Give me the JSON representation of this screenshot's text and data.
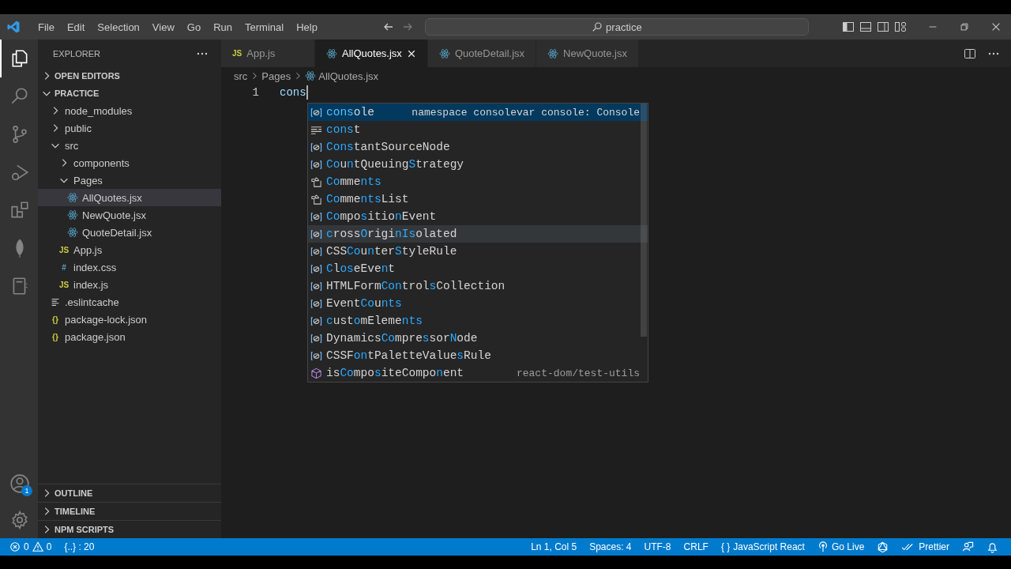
{
  "title_bar": {
    "menu": [
      "File",
      "Edit",
      "Selection",
      "View",
      "Go",
      "Run",
      "Terminal",
      "Help"
    ],
    "forward_disabled": true,
    "search": {
      "value": "practice"
    }
  },
  "activity_bar": {
    "items": [
      {
        "kind": "explorer",
        "selected": true
      },
      {
        "kind": "search",
        "selected": false
      },
      {
        "kind": "source-control",
        "selected": false
      },
      {
        "kind": "run-debug",
        "selected": false
      },
      {
        "kind": "extensions",
        "selected": false
      },
      {
        "kind": "leaf",
        "selected": false
      },
      {
        "kind": "notebook",
        "selected": false
      }
    ],
    "accounts_badge": "1"
  },
  "sidebar": {
    "title": "EXPLORER",
    "sections": [
      {
        "label": "OPEN EDITORS",
        "expanded": false
      },
      {
        "label": "PRACTICE",
        "expanded": true
      }
    ],
    "tree": [
      {
        "label": "node_modules",
        "kind": "folder",
        "expanded": false,
        "selected": false
      },
      {
        "label": "public",
        "kind": "folder",
        "expanded": false,
        "selected": false
      },
      {
        "label": "src",
        "kind": "folder",
        "expanded": true,
        "selected": false,
        "children": [
          {
            "label": "components",
            "kind": "folder",
            "expanded": false,
            "selected": false
          },
          {
            "label": "Pages",
            "kind": "folder",
            "expanded": true,
            "selected": false,
            "children": [
              {
                "label": "AllQuotes.jsx",
                "kind": "react",
                "selected": true
              },
              {
                "label": "NewQuote.jsx",
                "kind": "react",
                "selected": false
              },
              {
                "label": "QuoteDetail.jsx",
                "kind": "react",
                "selected": false
              }
            ]
          },
          {
            "label": "App.js",
            "kind": "js",
            "icon_text": "JS",
            "selected": false
          },
          {
            "label": "index.css",
            "kind": "css",
            "icon_text": "#",
            "selected": false
          },
          {
            "label": "index.js",
            "kind": "js",
            "icon_text": "JS",
            "selected": false
          }
        ]
      },
      {
        "label": ".eslintcache",
        "kind": "text",
        "selected": false
      },
      {
        "label": "package-lock.json",
        "kind": "json",
        "icon_text": "{}",
        "selected": false
      },
      {
        "label": "package.json",
        "kind": "json",
        "icon_text": "{}",
        "selected": false
      }
    ],
    "bottom_sections": [
      {
        "label": "OUTLINE",
        "expanded": false
      },
      {
        "label": "TIMELINE",
        "expanded": false
      },
      {
        "label": "NPM SCRIPTS",
        "expanded": false
      }
    ]
  },
  "tabs": [
    {
      "label": "App.js",
      "kind": "js",
      "icon_text": "JS",
      "selected": false
    },
    {
      "label": "AllQuotes.jsx",
      "kind": "react",
      "selected": true
    },
    {
      "label": "QuoteDetail.jsx",
      "kind": "react",
      "selected": false
    },
    {
      "label": "NewQuote.jsx",
      "kind": "react",
      "selected": false
    }
  ],
  "breadcrumb": [
    {
      "label": "src",
      "kind": "folder"
    },
    {
      "label": "Pages",
      "kind": "folder"
    },
    {
      "label": "AllQuotes.jsx",
      "kind": "react"
    }
  ],
  "editor": {
    "lines": [
      {
        "number": "1",
        "code": "cons"
      }
    ]
  },
  "suggestions": [
    {
      "label": "**cons**ole",
      "kind": "variable",
      "detail": "namespace consolevar console: Console",
      "selected": true,
      "hovered": false
    },
    {
      "label": "**cons**t",
      "kind": "keyword",
      "selected": false,
      "hovered": false
    },
    {
      "label": "**Cons**tantSourceNode",
      "kind": "variable",
      "selected": false,
      "hovered": false
    },
    {
      "label": "**Co**u**n**tQueuing**S**trategy",
      "kind": "variable",
      "selected": false,
      "hovered": false
    },
    {
      "label": "**Co**mme**nts**",
      "kind": "class",
      "selected": false,
      "hovered": false
    },
    {
      "label": "**Co**mme**nts**List",
      "kind": "class",
      "selected": false,
      "hovered": false
    },
    {
      "label": "**Co**mpo**s**itio**n**Event",
      "kind": "variable",
      "selected": false,
      "hovered": false
    },
    {
      "label": "**c**ross**O**rigi**nIs**olated",
      "kind": "variable",
      "selected": false,
      "hovered": true
    },
    {
      "label": "CSS**Co**u**n**ter**S**tyleRule",
      "kind": "variable",
      "selected": false,
      "hovered": false
    },
    {
      "label": "**C**l**os**eEve**n**t",
      "kind": "variable",
      "selected": false,
      "hovered": false
    },
    {
      "label": "HTMLForm**Con**trol**s**Collection",
      "kind": "variable",
      "selected": false,
      "hovered": false
    },
    {
      "label": "Event**Co**u**nts**",
      "kind": "variable",
      "selected": false,
      "hovered": false
    },
    {
      "label": "**c**ust**o**mEleme**nts**",
      "kind": "variable",
      "selected": false,
      "hovered": false
    },
    {
      "label": "Dynamics**Co**mpre**s**sor**N**ode",
      "kind": "variable",
      "selected": false,
      "hovered": false
    },
    {
      "label": "CSSF**on**tPaletteValue**s**Rule",
      "kind": "variable",
      "selected": false,
      "hovered": false
    },
    {
      "label": "is**Co**mpo**s**iteCompo**n**ent",
      "kind": "module",
      "detail": "react-dom/test-utils",
      "selected": false,
      "hovered": false
    }
  ],
  "status_bar": {
    "errors": "0",
    "warnings": "0",
    "left_items": [
      "{..} : 20"
    ],
    "right_items": [
      {
        "kind": "text",
        "label": "Ln 1, Col 5"
      },
      {
        "kind": "text",
        "label": "Spaces: 4"
      },
      {
        "kind": "text",
        "label": "UTF-8"
      },
      {
        "kind": "text",
        "label": "CRLF"
      },
      {
        "kind": "braces",
        "icon_text": "{ }",
        "label": "JavaScript React"
      },
      {
        "kind": "golive",
        "label": "Go Live"
      },
      {
        "kind": "graphql"
      },
      {
        "kind": "prettier",
        "label": "Prettier"
      },
      {
        "kind": "feedback"
      },
      {
        "kind": "bell"
      }
    ]
  }
}
